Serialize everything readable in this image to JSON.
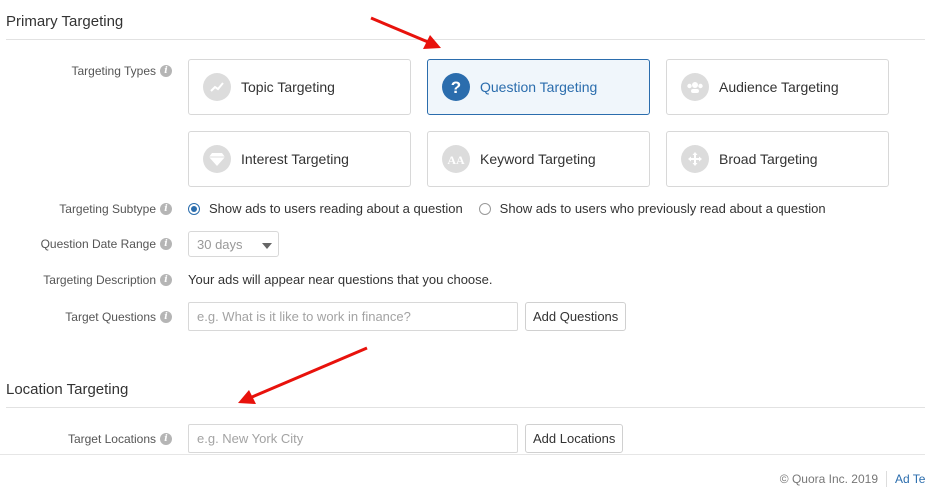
{
  "primary": {
    "title": "Primary Targeting",
    "labels": {
      "types": "Targeting Types",
      "subtype": "Targeting Subtype",
      "date_range": "Question Date Range",
      "description": "Targeting Description",
      "questions": "Target Questions"
    },
    "cards": [
      {
        "label": "Topic Targeting",
        "icon": "trend-icon",
        "selected": false
      },
      {
        "label": "Question Targeting",
        "icon": "question-icon",
        "selected": true
      },
      {
        "label": "Audience Targeting",
        "icon": "people-icon",
        "selected": false
      },
      {
        "label": "Interest Targeting",
        "icon": "diamond-icon",
        "selected": false
      },
      {
        "label": "Keyword Targeting",
        "icon": "keyword-icon",
        "selected": false
      },
      {
        "label": "Broad Targeting",
        "icon": "move-icon",
        "selected": false
      }
    ],
    "subtype_options": [
      {
        "label": "Show ads to users reading about a question",
        "checked": true
      },
      {
        "label": "Show ads to users who previously read about a question",
        "checked": false
      }
    ],
    "date_range_value": "30 days",
    "description_text": "Your ads will appear near questions that you choose.",
    "questions_placeholder": "e.g. What is it like to work in finance?",
    "add_questions_label": "Add Questions"
  },
  "location": {
    "title": "Location Targeting",
    "label": "Target Locations",
    "placeholder": "e.g. New York City",
    "add_label": "Add Locations"
  },
  "footer": {
    "copyright": "© Quora Inc. 2019",
    "link": "Ad Te"
  },
  "colors": {
    "accent": "#2b6dad",
    "annotation_arrow": "#e8120c"
  },
  "info_icon": "ⓘ"
}
